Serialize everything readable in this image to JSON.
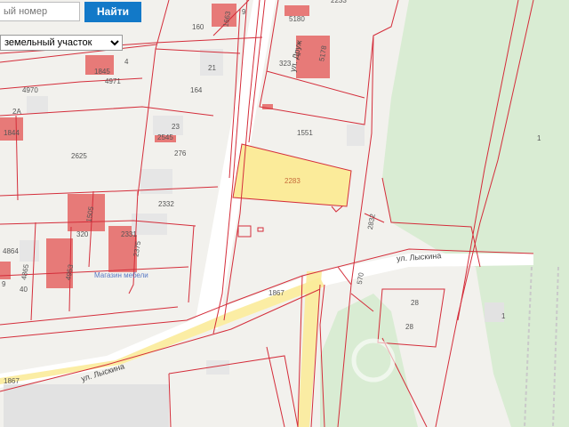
{
  "search": {
    "placeholder": "ый номер",
    "button_label": "Найти"
  },
  "select": {
    "selected": "земельный участок",
    "options": [
      "земельный участок"
    ]
  },
  "streets": {
    "druzhby": "ул. Друж",
    "lyskina_east": "ул. Лыскина",
    "lyskina_west": "ул. Лыскина"
  },
  "poi": {
    "furniture_store": "Магазин мебели"
  },
  "parcels": {
    "p160": "160",
    "p1663": "1663",
    "p5180": "5180",
    "p5178": "5178",
    "p323": "323",
    "p21": "21",
    "p164": "164",
    "p1845": "1845",
    "p4971": "4971",
    "p4970": "4970",
    "p2a": "2A",
    "p1844": "1844",
    "p1551": "1551",
    "p23": "23",
    "p2545": "2545",
    "p276": "276",
    "p2625": "2625",
    "p2283": "2283",
    "p2332": "2332",
    "p1505": "1505",
    "p320": "320",
    "p2331": "2331",
    "p2375": "2375",
    "p4864": "4864",
    "p4865": "4865",
    "p4953": "4953",
    "p2832": "2832",
    "p570": "570",
    "p1867a": "1867",
    "p1867b": "1867",
    "p28a": "28",
    "p28b": "28",
    "p1a": "1",
    "p1b": "1",
    "p4": "4",
    "p9": "9",
    "p40": "40",
    "p9b": "9",
    "p2233": "2233"
  },
  "colors": {
    "selected_fill": "#fbeb9a",
    "boundary": "#d42d3a",
    "building": "#e77a78",
    "green": "#d9ecd3",
    "road": "#ffffff",
    "background": "#f2f1ed"
  }
}
